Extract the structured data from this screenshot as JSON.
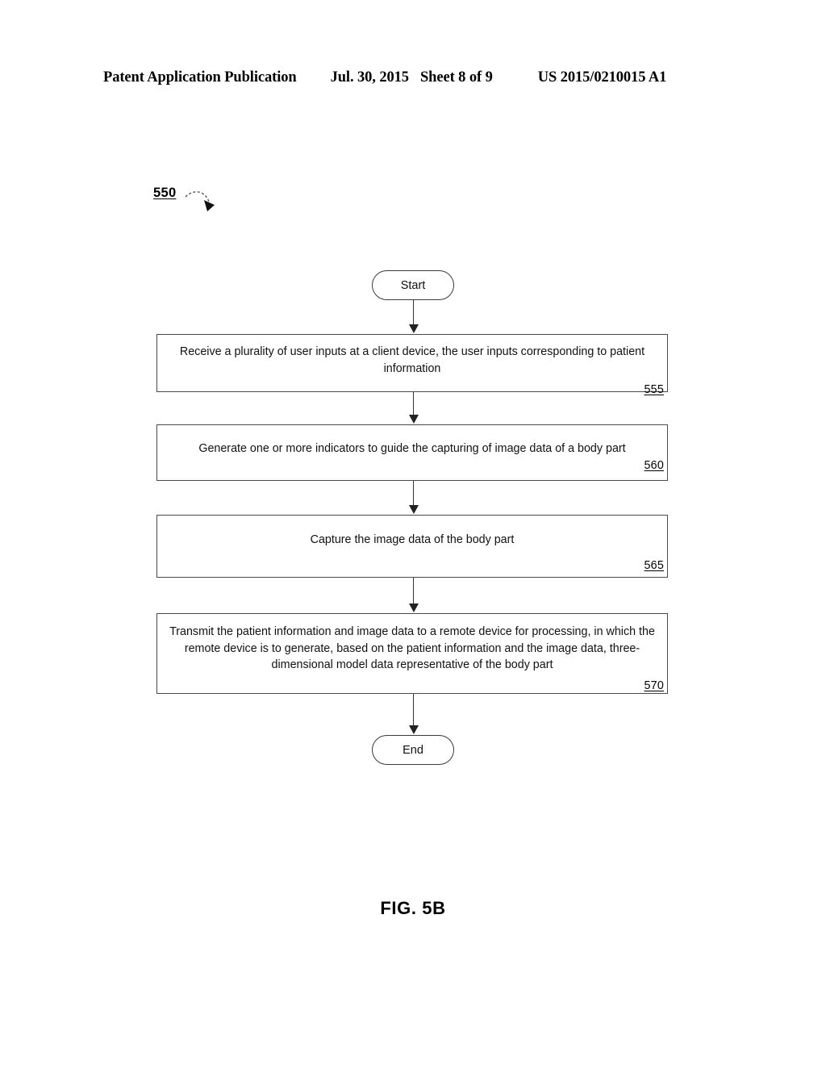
{
  "header": {
    "publication_title": "Patent Application Publication",
    "date": "Jul. 30, 2015",
    "sheet": "Sheet 8 of 9",
    "publication_number": "US 2015/0210015 A1"
  },
  "figure": {
    "reference_numeral": "550",
    "caption": "FIG. 5B"
  },
  "flowchart": {
    "start_label": "Start",
    "end_label": "End",
    "steps": [
      {
        "text": "Receive a plurality of user inputs at a client device, the user inputs corresponding to patient information",
        "numeral": "555"
      },
      {
        "text": "Generate one or more indicators to guide the capturing of image data of a body part",
        "numeral": "560"
      },
      {
        "text": "Capture the image data of the body part",
        "numeral": "565"
      },
      {
        "text": "Transmit the patient information and image data to a remote device for processing, in which the remote device is to generate, based on the patient information and the image data, three-dimensional model data representative of the body part",
        "numeral": "570"
      }
    ]
  }
}
